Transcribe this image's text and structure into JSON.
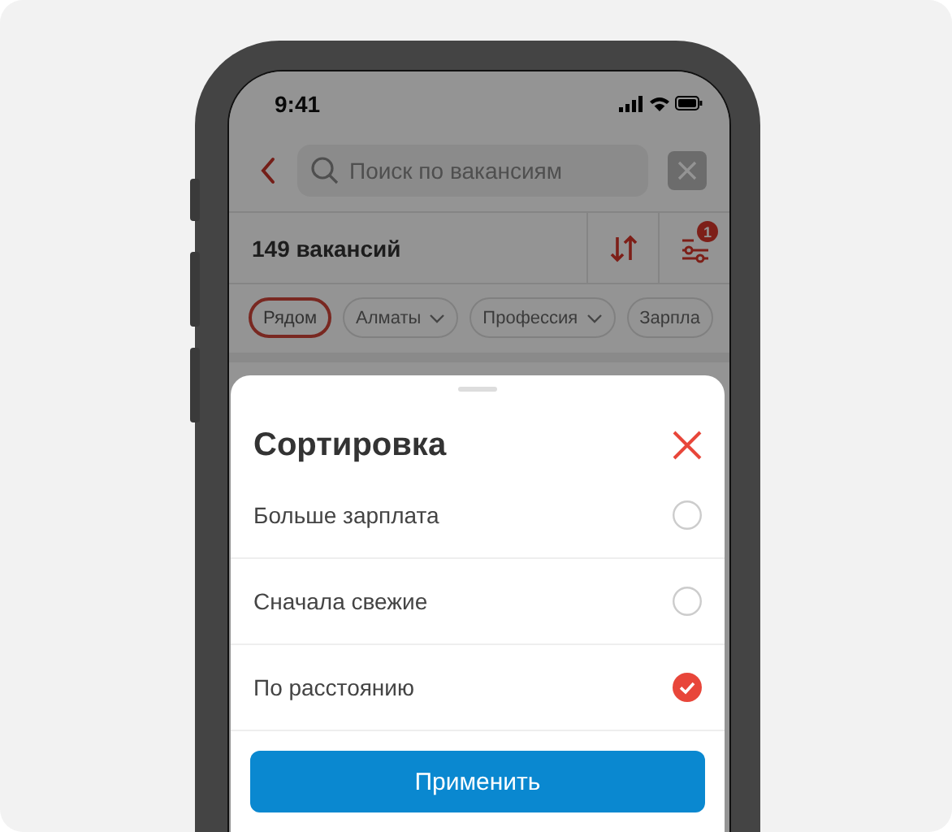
{
  "status_bar": {
    "time": "9:41"
  },
  "search": {
    "placeholder": "Поиск по вакансиям"
  },
  "results": {
    "count": "149 вакансий",
    "filter_badge": "1"
  },
  "chips": [
    {
      "label": "Рядом",
      "selected": true,
      "dropdown": false
    },
    {
      "label": "Алматы",
      "selected": false,
      "dropdown": true
    },
    {
      "label": "Профессия",
      "selected": false,
      "dropdown": true
    },
    {
      "label": "Зарпла",
      "selected": false,
      "dropdown": false
    }
  ],
  "sheet": {
    "title": "Сортировка",
    "options": [
      {
        "label": "Больше зарплата",
        "selected": false
      },
      {
        "label": "Сначала свежие",
        "selected": false
      },
      {
        "label": "По расстоянию",
        "selected": true
      }
    ],
    "apply_button": "Применить"
  }
}
